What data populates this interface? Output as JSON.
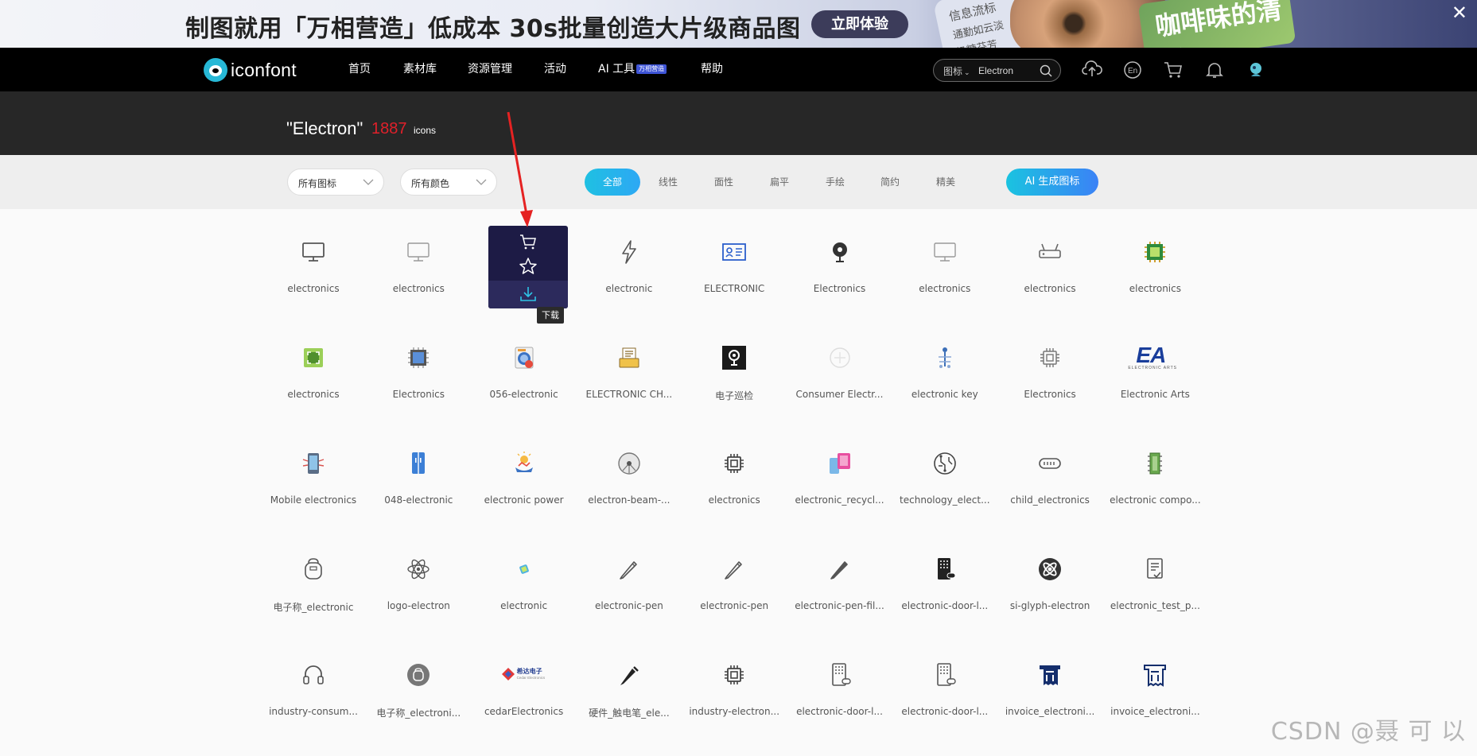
{
  "banner": {
    "headline": "制图就用「万相营造」低成本 30s批量创造大片级商品图",
    "cta": "立即体验",
    "deco_text_1": "信息流标",
    "deco_text_2": "通勤如云淡",
    "deco_text_3": "奶糖芬芳",
    "card_text": "咖啡味的清新",
    "close": "✕"
  },
  "nav": {
    "logo_text": "iconfont",
    "items": [
      "首页",
      "素材库",
      "资源管理",
      "活动",
      "AI 工具",
      "帮助"
    ],
    "ai_badge": "万相营造",
    "search": {
      "scope": "图标",
      "value": "Electron"
    }
  },
  "header": {
    "title": "\"Electron\"",
    "count": "1887",
    "unit": "icons"
  },
  "filters": {
    "icon_select": "所有图标",
    "color_select": "所有颜色",
    "styles": [
      "全部",
      "线性",
      "面性",
      "扁平",
      "手绘",
      "简约",
      "精美"
    ],
    "ai_button": "AI 生成图标"
  },
  "grid": {
    "rows": [
      [
        "electronics",
        "electronics",
        "",
        "electronic",
        "ELECTRONIC",
        "Electronics",
        "electronics",
        "electronics",
        "electronics"
      ],
      [
        "electronics",
        "Electronics",
        "056-electronic",
        "ELECTRONIC CH...",
        "电子巡检",
        "Consumer Electr...",
        "electronic key",
        "Electronics",
        "Electronic Arts"
      ],
      [
        "Mobile electronics",
        "048-electronic",
        "electronic power",
        "electron-beam-...",
        "electronics",
        "electronic_recycl...",
        "technology_elect...",
        "child_electronics",
        "electronic compo..."
      ],
      [
        "电子称_electronic",
        "logo-electron",
        "electronic",
        "electronic-pen",
        "electronic-pen",
        "electronic-pen-fil...",
        "electronic-door-l...",
        "si-glyph-electron",
        "electronic_test_p..."
      ],
      [
        "industry-consum...",
        "电子称_electroni...",
        "cedarElectronics",
        "硬件_触电笔_ele...",
        "industry-electron...",
        "electronic-door-l...",
        "electronic-door-l...",
        "invoice_electroni...",
        "invoice_electroni..."
      ]
    ],
    "hover": {
      "tooltip": "下载"
    }
  },
  "cedar_logo_text": "希达电子",
  "cedar_logo_sub": "Cedar Electronics",
  "ea_sub": "ELECTRONIC ARTS",
  "watermark": "CSDN @聂 可 以",
  "colors": {
    "accent": "#1fc0e2",
    "nav_bg": "#000000",
    "header_bg": "#272727",
    "count_red": "#e0202a",
    "hover_bg": "#1d1b45",
    "arrow": "#e52222"
  }
}
